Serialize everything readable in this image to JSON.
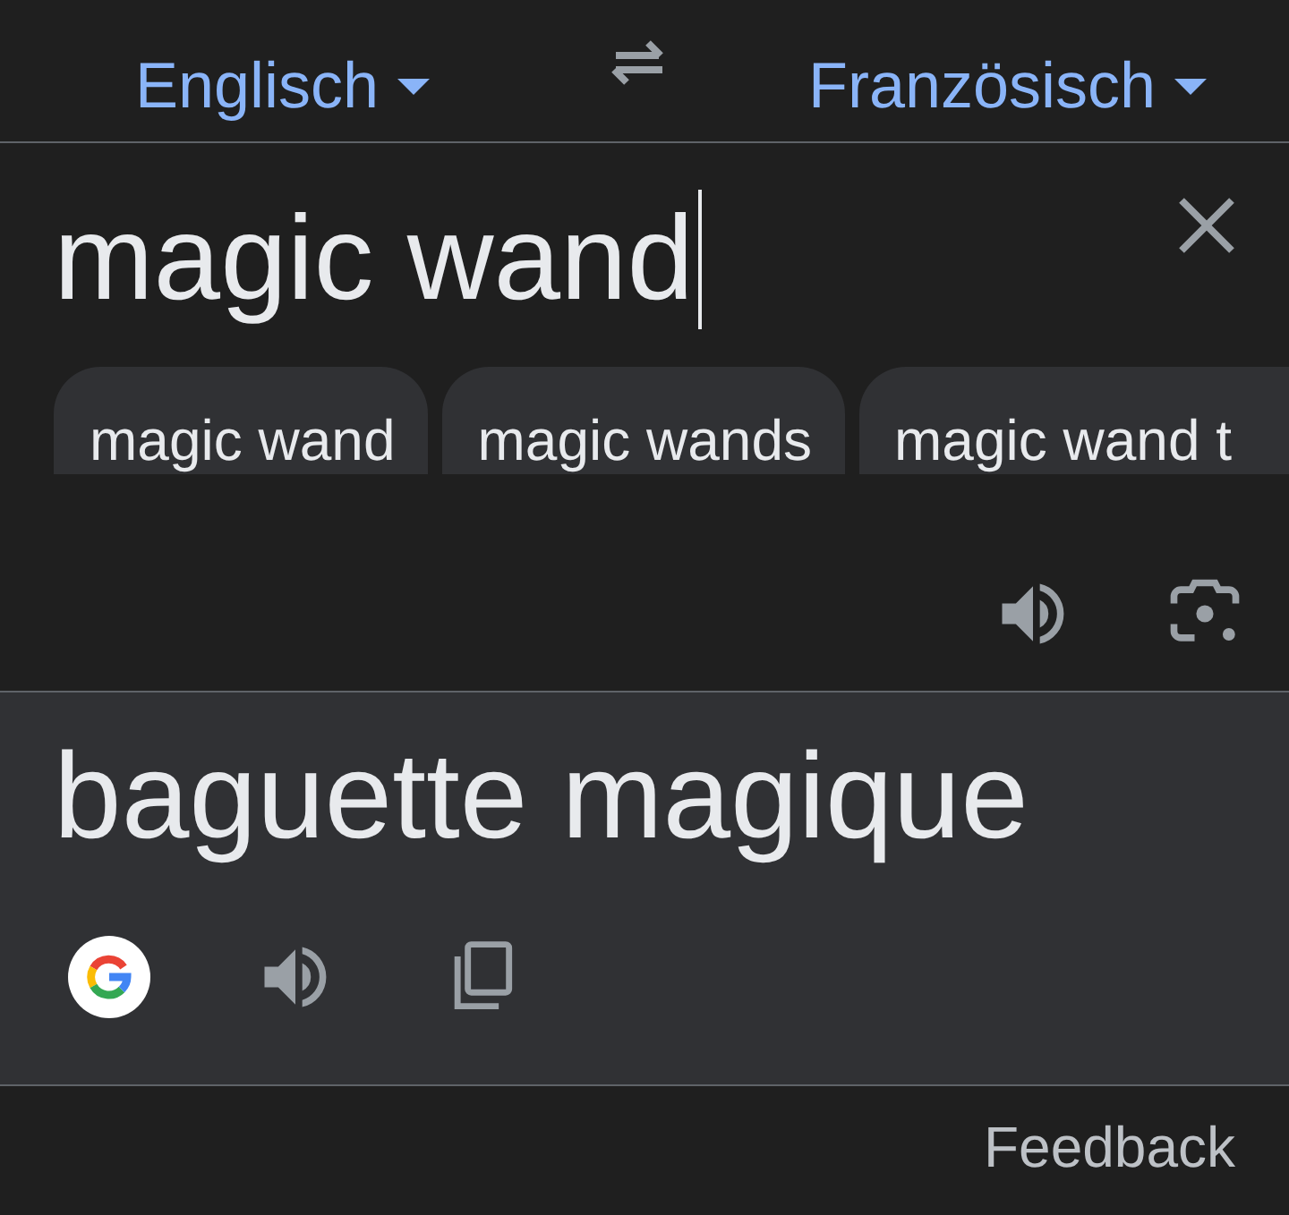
{
  "languages": {
    "source": "Englisch",
    "target": "Französisch"
  },
  "input": {
    "value": "magic wand"
  },
  "suggestions": [
    "magic wand",
    "magic wands",
    "magic wand t"
  ],
  "translation": {
    "text": "baguette magique"
  },
  "footer": {
    "link": "Feedback"
  }
}
